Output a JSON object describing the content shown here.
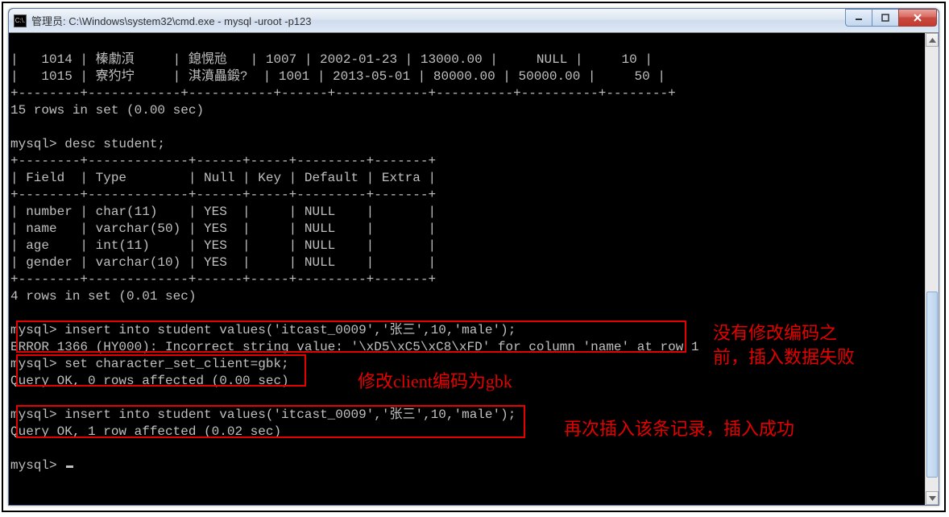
{
  "window": {
    "icon_label": "C:\\.",
    "title": "管理员: C:\\Windows\\system32\\cmd.exe - mysql  -uroot -p123"
  },
  "terminal_lines": [
    "|   1014 | 榛勮湏     | 鎴愰兘   | 1007 | 2002-01-23 | 13000.00 |     NULL |     10 |",
    "|   1015 | 寮犳坾     | 淇濆畾鍛?  | 1001 | 2013-05-01 | 80000.00 | 50000.00 |     50 |",
    "+--------+------------+-----------+------+------------+----------+----------+--------+",
    "15 rows in set (0.00 sec)",
    "",
    "mysql> desc student;",
    "+--------+-------------+------+-----+---------+-------+",
    "| Field  | Type        | Null | Key | Default | Extra |",
    "+--------+-------------+------+-----+---------+-------+",
    "| number | char(11)    | YES  |     | NULL    |       |",
    "| name   | varchar(50) | YES  |     | NULL    |       |",
    "| age    | int(11)     | YES  |     | NULL    |       |",
    "| gender | varchar(10) | YES  |     | NULL    |       |",
    "+--------+-------------+------+-----+---------+-------+",
    "4 rows in set (0.01 sec)",
    "",
    "mysql> insert into student values('itcast_0009','张三',10,'male');",
    "ERROR 1366 (HY000): Incorrect string value: '\\xD5\\xC5\\xC8\\xFD' for column 'name' at row 1",
    "mysql> set character_set_client=gbk;",
    "Query OK, 0 rows affected (0.00 sec)",
    "",
    "mysql> insert into student values('itcast_0009','张三',10,'male');",
    "Query OK, 1 row affected (0.02 sec)",
    "",
    "mysql> "
  ],
  "annotations": {
    "a1": "没有修改编码之\n前，插入数据失败",
    "a2": "修改client编码为gbk",
    "a3": "再次插入该条记录，插入成功"
  }
}
